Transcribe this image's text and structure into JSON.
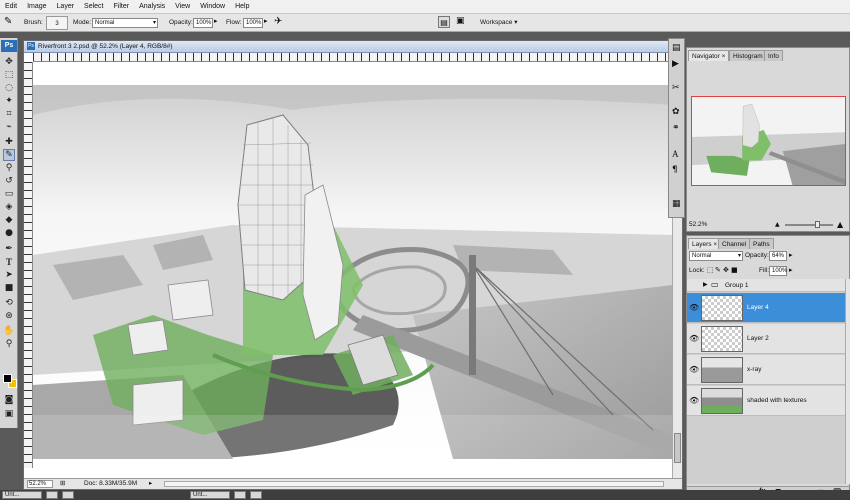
{
  "menu": [
    "Edit",
    "Image",
    "Layer",
    "Select",
    "Filter",
    "Analysis",
    "View",
    "Window",
    "Help"
  ],
  "options_bar": {
    "brush_label": "Brush:",
    "brush_size": "3",
    "mode_label": "Mode:",
    "mode_value": "Normal",
    "opacity_label": "Opacity:",
    "opacity_value": "100%",
    "flow_label": "Flow:",
    "flow_value": "100%",
    "workspace_label": "Workspace"
  },
  "document": {
    "title": "Riverfront 3 2.psd @ 52.2% (Layer 4, RGB/8#)",
    "zoom": "52.2%",
    "doc_size": "Doc: 8.33M/35.9M"
  },
  "toolbox": {
    "badge": "Ps",
    "tools": [
      "move-tool-icon",
      "marquee-tool-icon",
      "lasso-tool-icon",
      "magic-wand-tool-icon",
      "crop-tool-icon",
      "eyedropper-tool-icon",
      "healing-brush-tool-icon",
      "brush-tool-icon",
      "clone-stamp-tool-icon",
      "history-brush-tool-icon",
      "eraser-tool-icon",
      "paint-bucket-tool-icon",
      "blur-tool-icon",
      "dodge-tool-icon",
      "pen-tool-icon",
      "type-tool-icon",
      "path-selection-tool-icon",
      "shape-tool-icon",
      "3d-rotate-tool-icon",
      "3d-orbit-tool-icon",
      "hand-tool-icon",
      "zoom-tool-icon"
    ]
  },
  "navigator": {
    "tabs": [
      "Navigator",
      "Histogram",
      "Info"
    ],
    "zoom": "52.2%"
  },
  "layers_panel": {
    "tabs": [
      "Layers",
      "Channel",
      "Paths"
    ],
    "blend_mode": "Normal",
    "opacity_label": "Opacity:",
    "opacity_value": "64%",
    "lock_label": "Lock:",
    "fill_label": "Fill:",
    "fill_value": "100%",
    "layers": [
      {
        "name": "Group 1",
        "type": "group",
        "selected": false
      },
      {
        "name": "Layer 4",
        "type": "layer",
        "selected": true
      },
      {
        "name": "Layer 2",
        "type": "layer",
        "selected": false
      },
      {
        "name": "x-ray",
        "type": "layer",
        "selected": false
      },
      {
        "name": "shaded with textures",
        "type": "layer",
        "selected": false
      }
    ],
    "footer_icons": [
      "link-layers-icon",
      "fx-icon",
      "mask-icon",
      "adjustment-icon",
      "new-group-icon",
      "new-layer-icon",
      "trash-icon"
    ]
  },
  "taskbar": {
    "items": [
      "Unt...",
      "Unt..."
    ]
  },
  "colors": {
    "selection_blue": "#3c8ed9",
    "foreground": "#000000",
    "background": "#f2c200",
    "green_roofs": "#6fae5e"
  }
}
